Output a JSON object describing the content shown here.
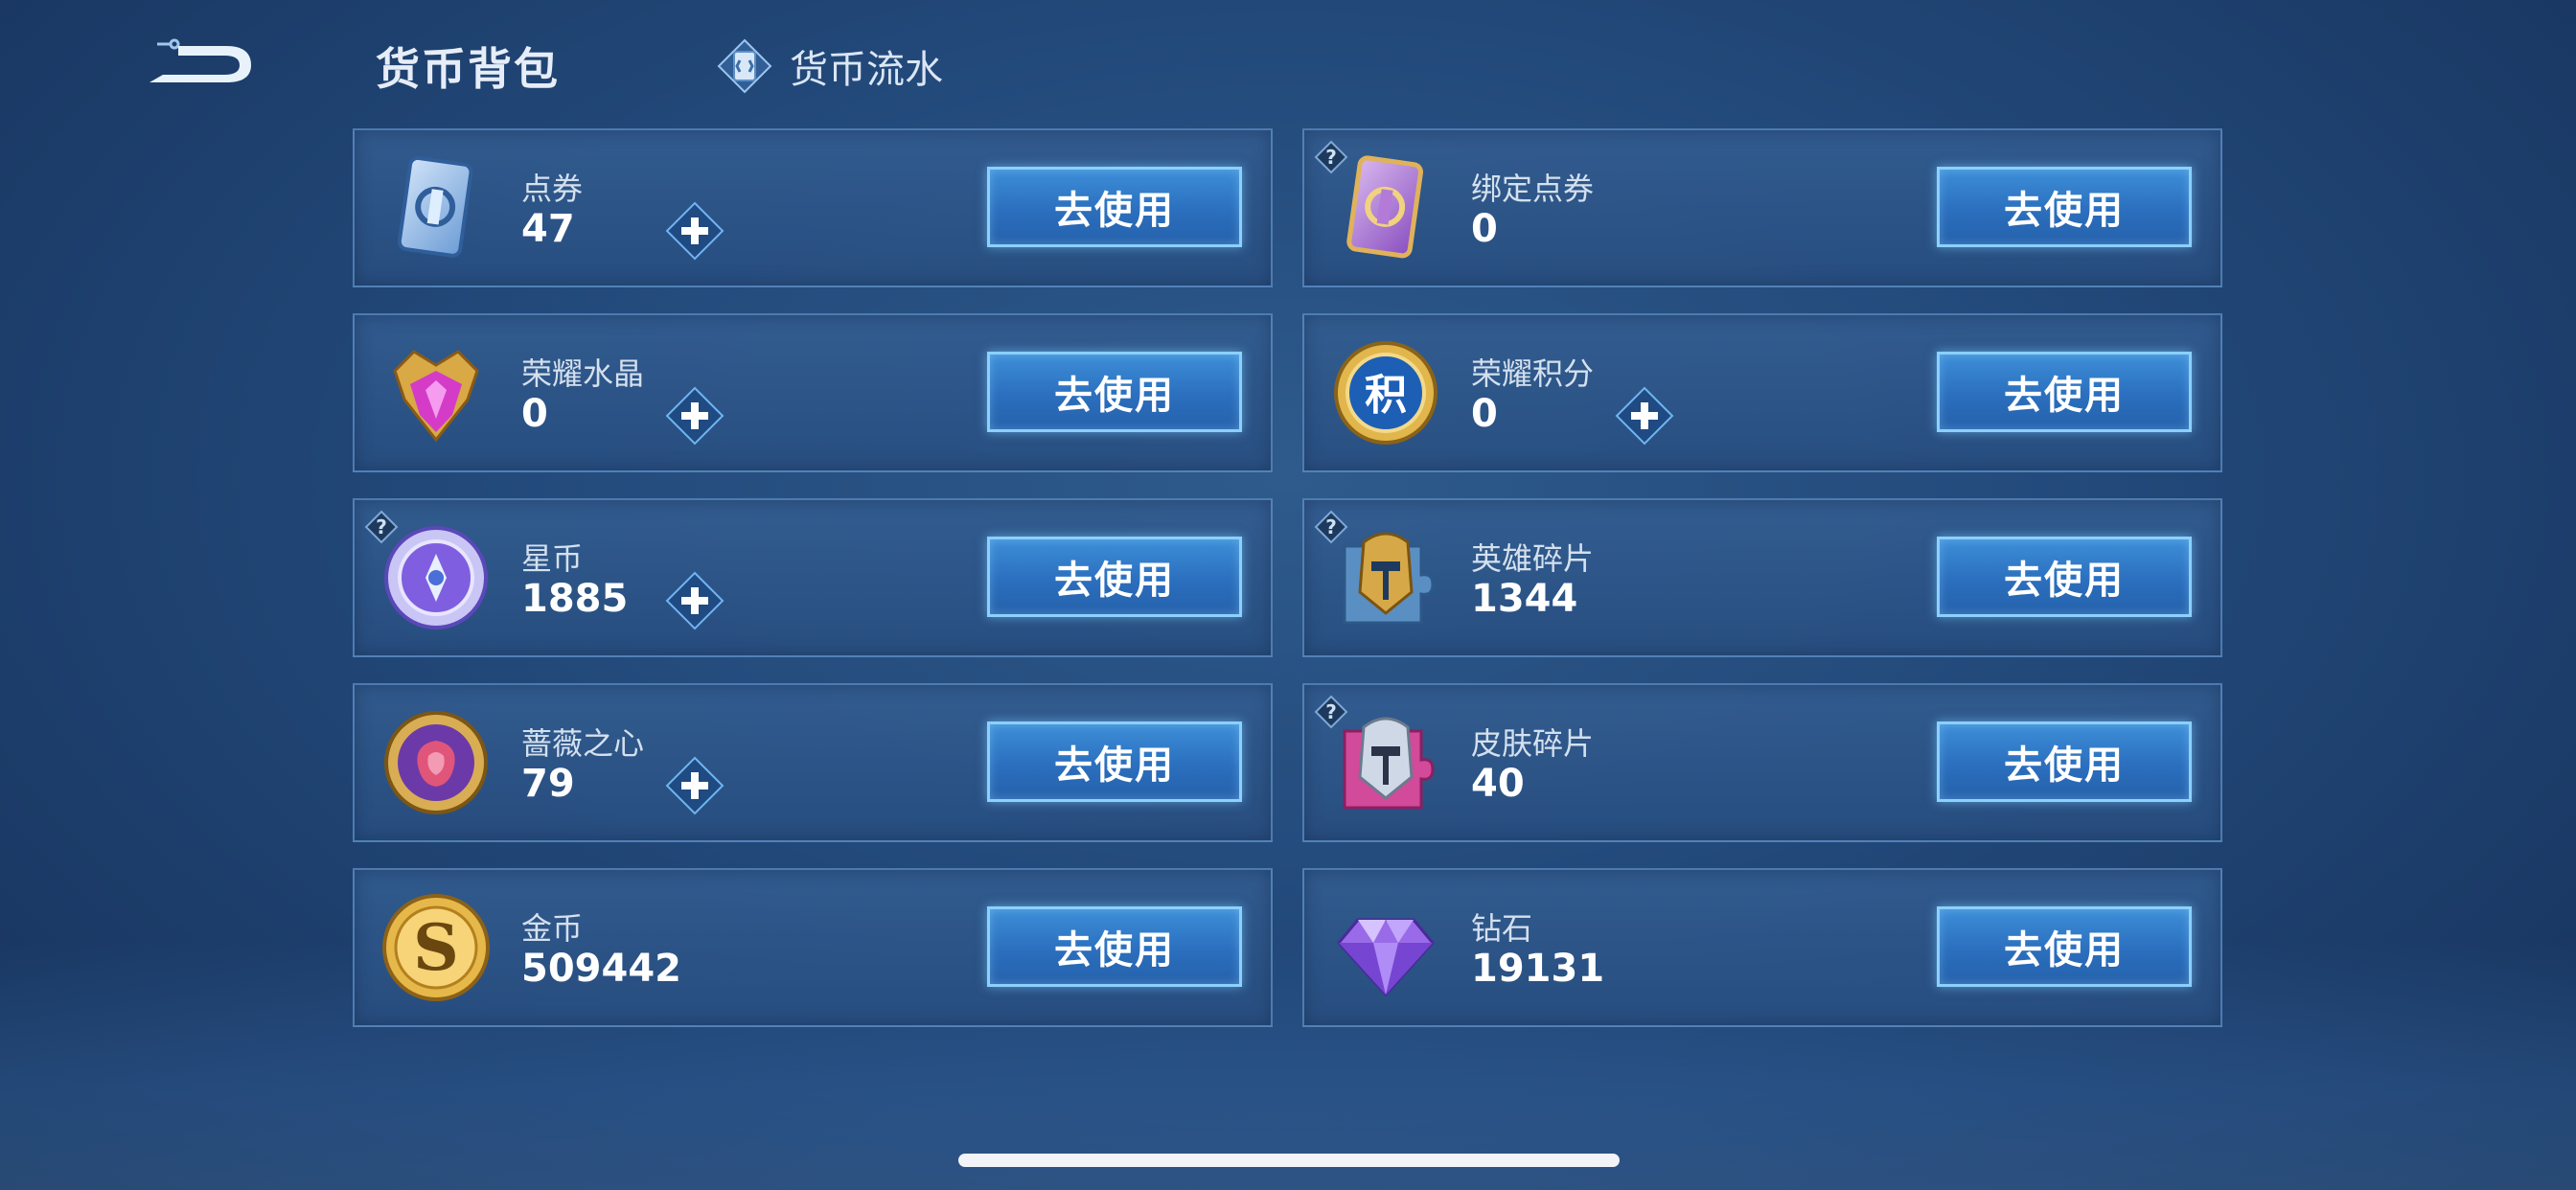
{
  "header": {
    "title": "货币背包",
    "flow_tab_label": "货币流水"
  },
  "use_label": "去使用",
  "currencies": [
    {
      "name": "点券",
      "amount": "47",
      "has_plus": true,
      "has_help": false,
      "icon": "voucher-icon"
    },
    {
      "name": "绑定点券",
      "amount": "0",
      "has_plus": false,
      "has_help": true,
      "icon": "bound-voucher-icon"
    },
    {
      "name": "荣耀水晶",
      "amount": "0",
      "has_plus": true,
      "has_help": false,
      "icon": "glory-crystal-icon"
    },
    {
      "name": "荣耀积分",
      "amount": "0",
      "has_plus": true,
      "has_help": false,
      "icon": "glory-points-icon"
    },
    {
      "name": "星币",
      "amount": "1885",
      "has_plus": true,
      "has_help": true,
      "icon": "star-coin-icon"
    },
    {
      "name": "英雄碎片",
      "amount": "1344",
      "has_plus": false,
      "has_help": true,
      "icon": "hero-fragment-icon"
    },
    {
      "name": "蔷薇之心",
      "amount": "79",
      "has_plus": true,
      "has_help": false,
      "icon": "rose-heart-icon"
    },
    {
      "name": "皮肤碎片",
      "amount": "40",
      "has_plus": false,
      "has_help": true,
      "icon": "skin-fragment-icon"
    },
    {
      "name": "金币",
      "amount": "509442",
      "has_plus": false,
      "has_help": false,
      "icon": "gold-coin-icon"
    },
    {
      "name": "钻石",
      "amount": "19131",
      "has_plus": false,
      "has_help": false,
      "icon": "diamond-icon"
    }
  ],
  "colors": {
    "accent_button": "#2b6fbe",
    "button_border": "#8cd0ff",
    "card_bg": "#345e92"
  }
}
